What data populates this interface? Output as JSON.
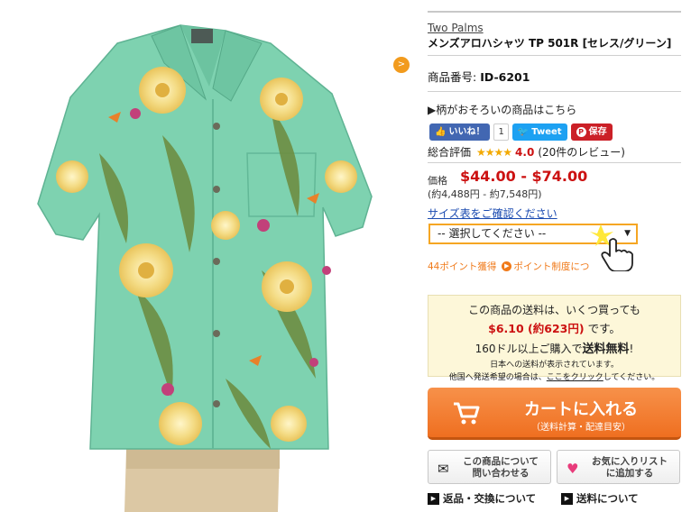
{
  "product": {
    "brand": "Two Palms",
    "name": "メンズアロハシャツ TP 501R [セレス/グリーン]",
    "id_label": "商品番号:",
    "id_value": "ID-6201",
    "pattern_link": "▶柄がおそろいの商品はこちら"
  },
  "social": {
    "fb_label": "いいね！",
    "fb_count": "1",
    "tweet_label": "Tweet",
    "pin_label": "保存"
  },
  "rating": {
    "label": "総合評価",
    "stars": "★★★★",
    "score": "4.0",
    "reviews": "(20件のレビュー)"
  },
  "price": {
    "label": "価格",
    "range": "$44.00 - $74.00",
    "yen": "(約4,488円 - 約7,548円)"
  },
  "size_link": "サイズ表をご確認ください",
  "select": {
    "value": "-- 選択してください --"
  },
  "points": {
    "earn": "44ポイント獲得",
    "system": "ポイント制度につ"
  },
  "shipping": {
    "line1": "この商品の送料は、いくつ買っても",
    "line2_red": "$6.10 (約623円)",
    "line2_rest": "です。",
    "line3_pre": "160ドル以上ご購入で",
    "line3_bold": "送料無料",
    "line3_post": "!",
    "line4": "日本への送料が表示されています。",
    "line5_pre": "他国へ発送希望の場合は、",
    "line5_link": "ここをクリック",
    "line5_post": "してください。"
  },
  "cart": {
    "label": "カートに入れる",
    "sub": "（送料計算・配達目安）"
  },
  "buttons": {
    "contact_l1": "この商品について",
    "contact_l2": "問い合わせる",
    "fav_l1": "お気に入りリスト",
    "fav_l2": "に追加する"
  },
  "links": {
    "returns": "返品・交換について",
    "shipping": "送料について"
  },
  "colors": {
    "accent_orange": "#ef6f20",
    "price_red": "#cc1111",
    "shirt_green": "#7ed2b0",
    "link_blue": "#1a4ab0"
  }
}
